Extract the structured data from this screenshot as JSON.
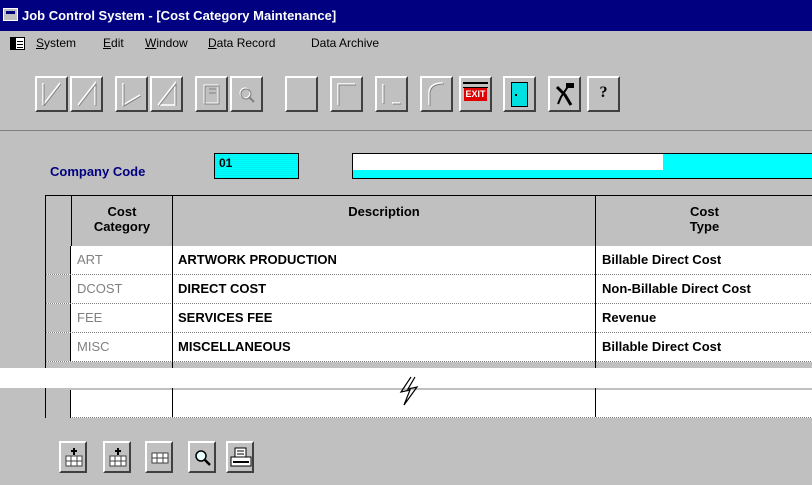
{
  "window": {
    "title": "Job Control System - [Cost Category Maintenance]"
  },
  "menu": {
    "items": [
      {
        "label": "System",
        "accel": "S"
      },
      {
        "label": "Edit",
        "accel": "E"
      },
      {
        "label": "Window",
        "accel": "W"
      },
      {
        "label": "Data Record",
        "accel": "D"
      },
      {
        "label": "Data Archive",
        "accel": ""
      }
    ]
  },
  "toolbar": {
    "buttons": [
      {
        "name": "first-record",
        "icon": "first-record-icon",
        "enabled": false
      },
      {
        "name": "previous-record",
        "icon": "previous-record-icon",
        "enabled": false
      },
      {
        "name": "next-record",
        "icon": "next-record-icon",
        "enabled": false
      },
      {
        "name": "last-record",
        "icon": "last-record-icon",
        "enabled": false
      },
      {
        "name": "new-record",
        "icon": "new-record-icon",
        "enabled": false
      },
      {
        "name": "find-record",
        "icon": "find-icon",
        "enabled": false
      },
      {
        "name": "blank-1",
        "icon": "blank-icon",
        "enabled": false
      },
      {
        "name": "blank-2",
        "icon": "page-icon",
        "enabled": false
      },
      {
        "name": "blank-3",
        "icon": "clear-icon",
        "enabled": false
      },
      {
        "name": "undo",
        "icon": "undo-icon",
        "enabled": false
      },
      {
        "name": "exit",
        "icon": "exit-icon",
        "label": "EXIT",
        "enabled": true
      },
      {
        "name": "door",
        "icon": "door-icon",
        "enabled": true
      },
      {
        "name": "tools",
        "icon": "tools-icon",
        "enabled": true
      },
      {
        "name": "help",
        "icon": "help-icon",
        "label": "?",
        "enabled": true
      }
    ]
  },
  "form": {
    "company_code_label": "Company Code",
    "company_code_value": "01",
    "company_name_value": ""
  },
  "grid": {
    "columns": [
      {
        "line1": "Cost",
        "line2": "Category"
      },
      {
        "line1": "Description",
        "line2": ""
      },
      {
        "line1": "Cost",
        "line2": "Type"
      }
    ],
    "rows": [
      {
        "code": "ART",
        "description": "ARTWORK PRODUCTION",
        "type": "Billable Direct Cost"
      },
      {
        "code": "DCOST",
        "description": "DIRECT COST",
        "type": "Non-Billable Direct Cost"
      },
      {
        "code": "FEE",
        "description": "SERVICES FEE",
        "type": "Revenue"
      },
      {
        "code": "MISC",
        "description": "MISCELLANEOUS",
        "type": "Billable Direct Cost"
      },
      {
        "code": "",
        "description": "",
        "type": ""
      }
    ]
  },
  "bottom_buttons": [
    {
      "name": "insert-row",
      "icon": "insert-row-icon"
    },
    {
      "name": "add-row",
      "icon": "add-row-icon"
    },
    {
      "name": "delete-row",
      "icon": "delete-row-icon"
    },
    {
      "name": "lookup",
      "icon": "magnifier-icon"
    },
    {
      "name": "print",
      "icon": "printer-icon"
    }
  ],
  "colors": {
    "title_bar": "#000080",
    "face": "#c0c0c0",
    "input_fill": "#00ffff",
    "label_blue": "#000080",
    "exit_red": "#e00000"
  }
}
